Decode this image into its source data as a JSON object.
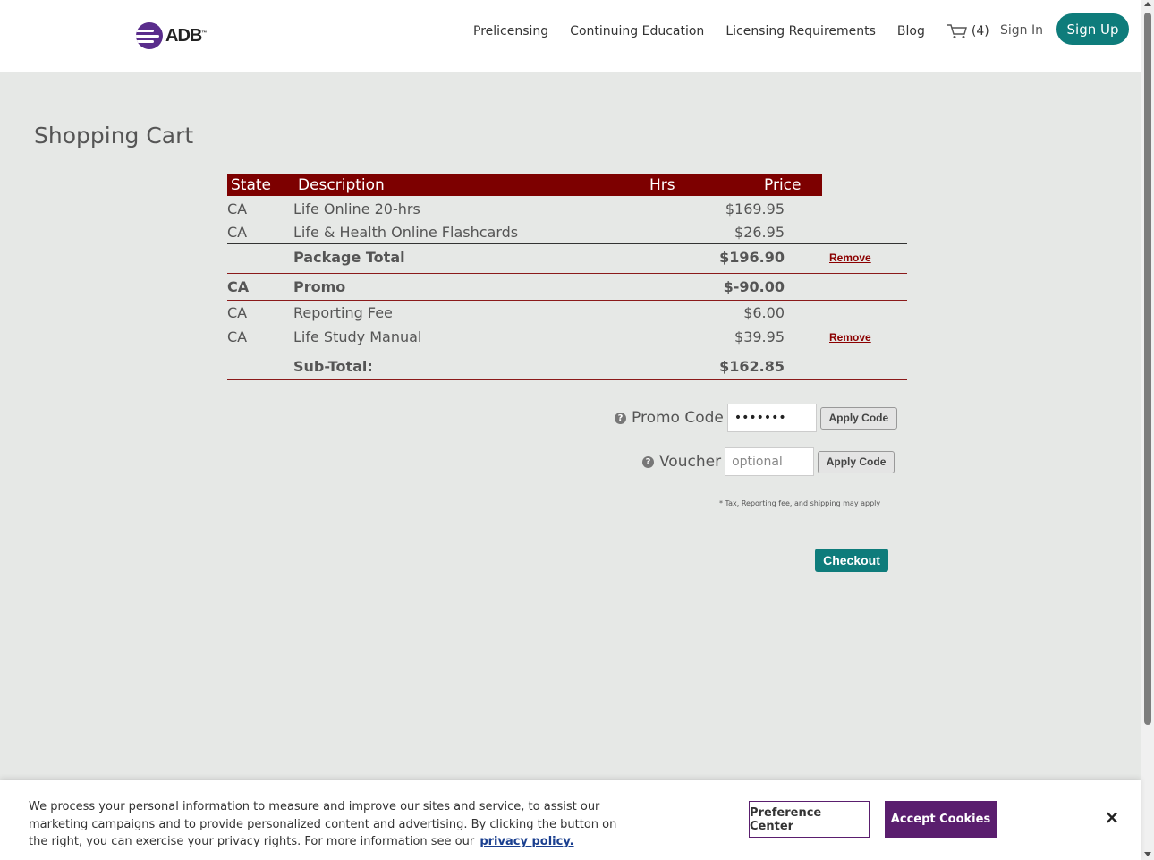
{
  "header": {
    "logo_text": "ADB",
    "logo_tm": "™",
    "nav": [
      "Prelicensing",
      "Continuing Education",
      "Licensing Requirements",
      "Blog"
    ],
    "cart_count": "(4)",
    "signin": "Sign In",
    "signup": "Sign Up"
  },
  "page": {
    "title": "Shopping Cart"
  },
  "cart": {
    "columns": {
      "state": "State",
      "description": "Description",
      "hrs": "Hrs",
      "price": "Price"
    },
    "rows": [
      {
        "state": "CA",
        "description": "Life Online 20-hrs",
        "price": "$169.95"
      },
      {
        "state": "CA",
        "description": "Life & Health Online Flashcards",
        "price": "$26.95"
      }
    ],
    "package_total": {
      "label": "Package Total",
      "price": "$196.90",
      "remove": "Remove"
    },
    "promo": {
      "state": "CA",
      "label": "Promo",
      "price": "$-90.00"
    },
    "extra_rows": [
      {
        "state": "CA",
        "description": "Reporting Fee",
        "price": "$6.00"
      },
      {
        "state": "CA",
        "description": "Life Study Manual",
        "price": "$39.95",
        "remove": "Remove"
      }
    ],
    "subtotal": {
      "label": "Sub-Total:",
      "price": "$162.85"
    }
  },
  "codes": {
    "help_glyph": "?",
    "promo_label": "Promo Code",
    "promo_value": "•••••••",
    "voucher_label": "Voucher",
    "voucher_placeholder": "optional",
    "apply_label": "Apply Code",
    "tax_note": "* Tax, Reporting fee, and shipping may apply",
    "checkout_label": "Checkout"
  },
  "cookie": {
    "text": "We process your personal information to measure and improve our sites and service, to assist our marketing campaigns and to provide personalized content and advertising. By clicking the button on the right, you can exercise your privacy rights. For more information see our",
    "link": "privacy policy.",
    "preference": "Preference Center",
    "accept": "Accept Cookies",
    "close": "×"
  },
  "colors": {
    "brand_teal": "#0e7c7b",
    "table_header": "#7d0000",
    "cookie_purple": "#5a1e6e",
    "logo_purple": "#5a2d8c"
  },
  "icons": [
    "cart-icon",
    "help-icon",
    "close-icon",
    "logo-icon"
  ]
}
